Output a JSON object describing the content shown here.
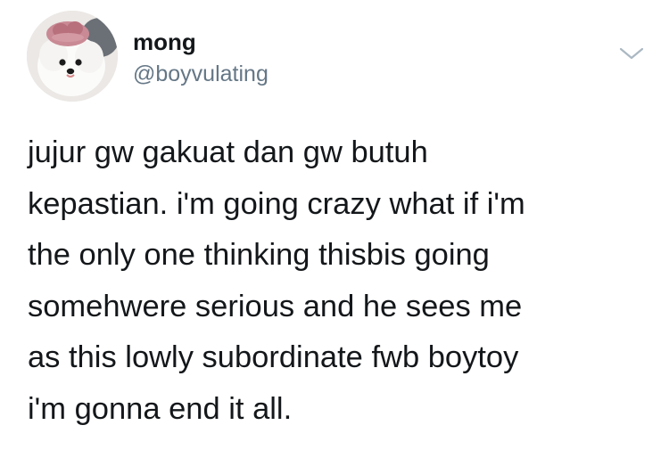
{
  "author": {
    "display_name": "mong",
    "handle": "@boyvulating",
    "avatar_icon": "dog-avatar-icon"
  },
  "menu": {
    "icon": "chevron-down-icon",
    "color": "#aab8c2"
  },
  "tweet": {
    "lines": [
      "jujur gw gakuat dan gw butuh",
      "kepastian. i'm going crazy what if i'm",
      "the only one thinking thisbis going",
      "somehwere serious and he sees me",
      "as this lowly subordinate fwb boytoy",
      "i'm gonna end it all."
    ]
  },
  "colors": {
    "text": "#14171a",
    "secondary": "#657786",
    "background": "#ffffff"
  }
}
